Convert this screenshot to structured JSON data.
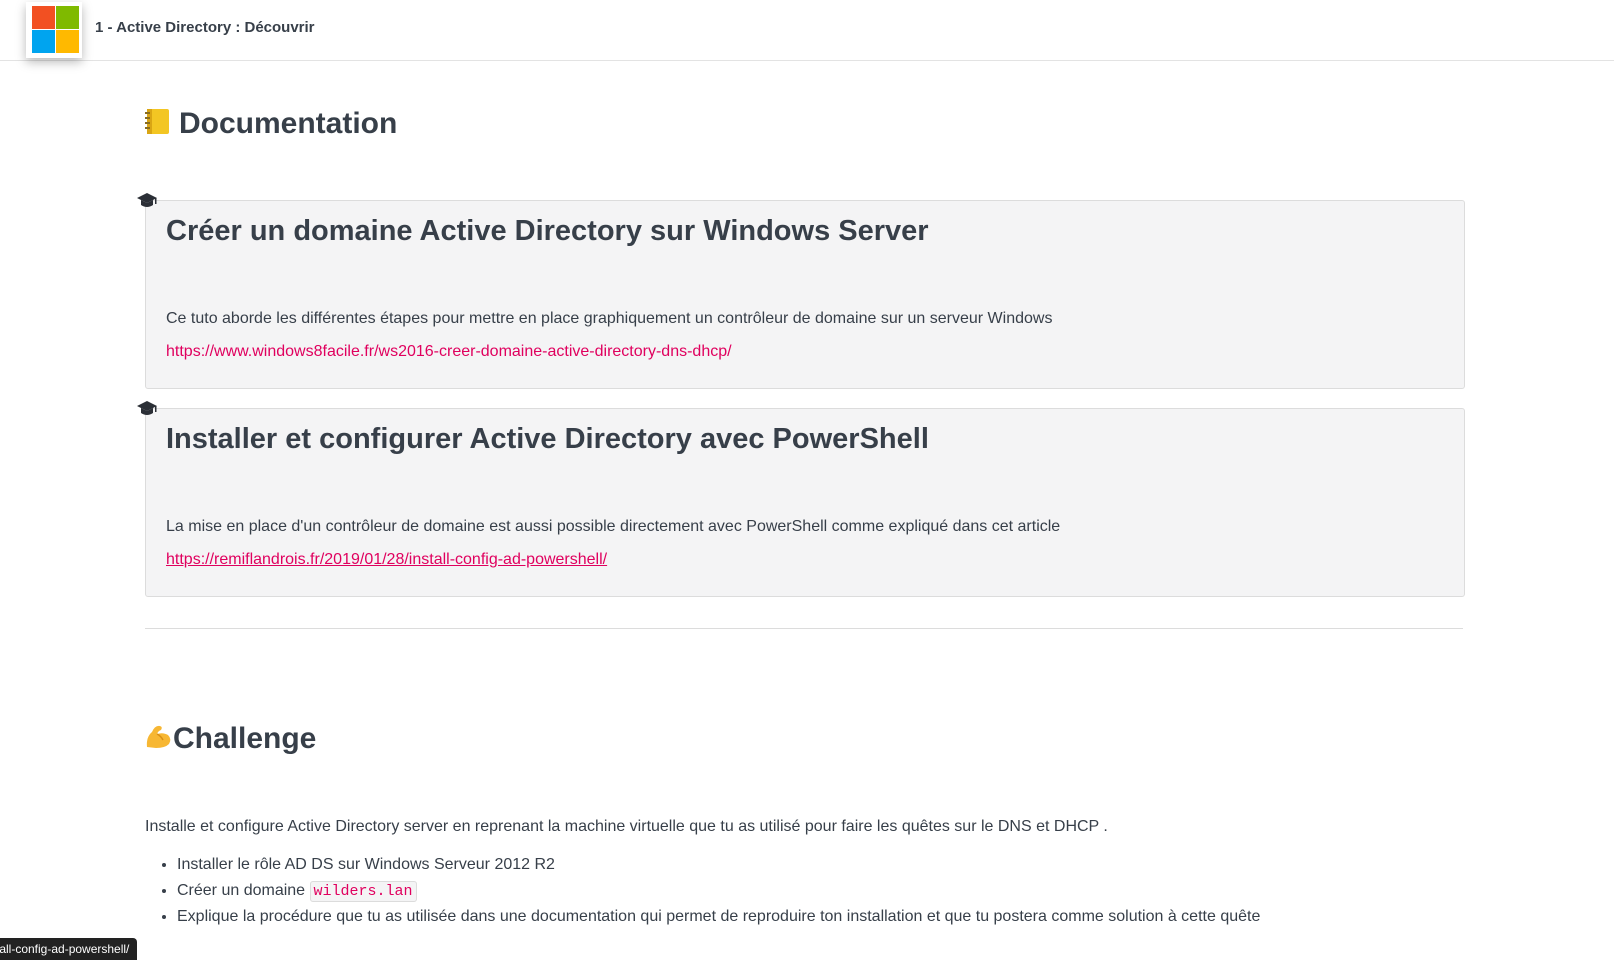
{
  "header": {
    "title": "1 - Active Directory : Découvrir"
  },
  "documentation": {
    "heading": "Documentation",
    "heading_emoji": "notebook-emoji",
    "cards": [
      {
        "icon": "graduation-cap-icon",
        "title": "Créer un domaine Active Directory sur Windows Server",
        "description": "Ce tuto aborde les différentes étapes pour mettre en place graphiquement un contrôleur de domaine sur un serveur Windows",
        "link": "https://www.windows8facile.fr/ws2016-creer-domaine-active-directory-dns-dhcp/"
      },
      {
        "icon": "graduation-cap-icon",
        "title": "Installer et configurer Active Directory avec PowerShell",
        "description": "La mise en place d'un contrôleur de domaine est aussi possible directement avec PowerShell comme expliqué dans cet article",
        "link": "https://remiflandrois.fr/2019/01/28/install-config-ad-powershell/"
      }
    ]
  },
  "challenge": {
    "heading": "Challenge",
    "heading_emoji": "flexed-biceps-emoji",
    "intro": "Installe et configure Active Directory server en reprenant la machine virtuelle que tu as utilisé pour faire les quêtes sur le DNS et DHCP .",
    "tasks": [
      {
        "text": "Installer le rôle AD DS sur Windows Serveur 2012 R2"
      },
      {
        "text": "Créer un domaine ",
        "code": "wilders.lan"
      },
      {
        "text": "Explique la procédure que tu as utilisée dans une documentation qui permet de reproduire ton installation et que tu postera comme solution à cette quête"
      }
    ]
  },
  "status_bar": {
    "url_preview": "tall-config-ad-powershell/"
  },
  "colors": {
    "link": "#e0005e",
    "text": "#373f49",
    "card_bg": "#f4f4f5"
  }
}
